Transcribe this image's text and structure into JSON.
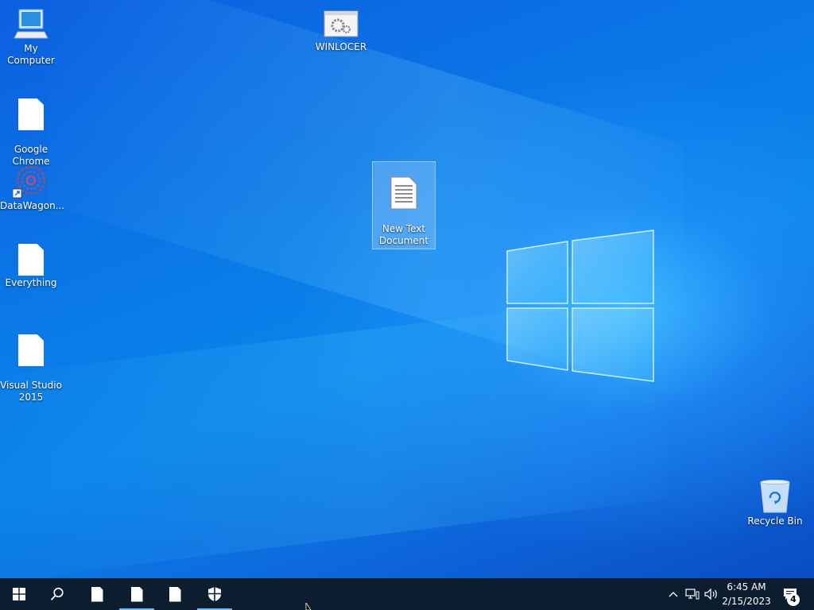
{
  "desktop": {
    "icons": [
      {
        "label": "My Computer"
      },
      {
        "label": "WINLOCER"
      },
      {
        "label": "Google\nChrome"
      },
      {
        "label": "DataWagon..."
      },
      {
        "label": "New Text\nDocument"
      },
      {
        "label": "Everything"
      },
      {
        "label": "Visual Studio\n2015"
      },
      {
        "label": "Recycle Bin"
      }
    ]
  },
  "taskbar": {
    "start_icon": "windows-start-icon",
    "search_icon": "search-icon",
    "apps": [
      {
        "icon": "document-icon"
      },
      {
        "icon": "document-icon",
        "active": true
      },
      {
        "icon": "document-icon"
      },
      {
        "icon": "shield-icon",
        "active": true
      }
    ],
    "tray": {
      "chevron_icon": "chevron-up-icon",
      "network_icon": "network-icon",
      "volume_icon": "volume-icon",
      "time": "6:45 AM",
      "date": "2/15/2023",
      "notifications_icon": "action-center-icon",
      "notification_count": "4"
    }
  },
  "colors": {
    "taskbar": "#0b1d2e",
    "desktop_blue": "#0a78e6",
    "active_indicator": "#76b9ed"
  }
}
